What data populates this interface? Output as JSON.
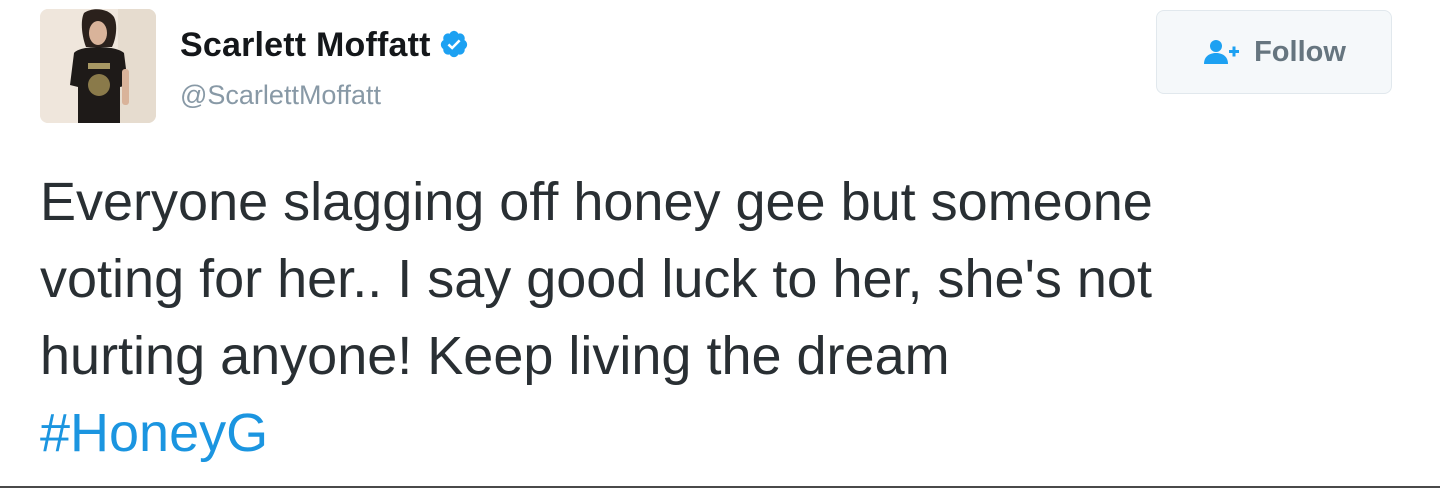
{
  "tweet": {
    "author": {
      "display_name": "Scarlett Moffatt",
      "handle": "@ScarlettMoffatt",
      "verified": true
    },
    "follow_button": {
      "label": "Follow",
      "icon": "follow-person-plus-icon"
    },
    "text_lines": [
      "Everyone slagging off honey gee but someone",
      "voting for her.. I say good luck to her, she's not",
      "hurting anyone! Keep living the dream"
    ],
    "hashtag": "#HoneyG"
  },
  "colors": {
    "text": "#292f33",
    "handle": "#8899a6",
    "link": "#1b95e0",
    "verified": "#1da1f2",
    "follow_text": "#66757f"
  }
}
